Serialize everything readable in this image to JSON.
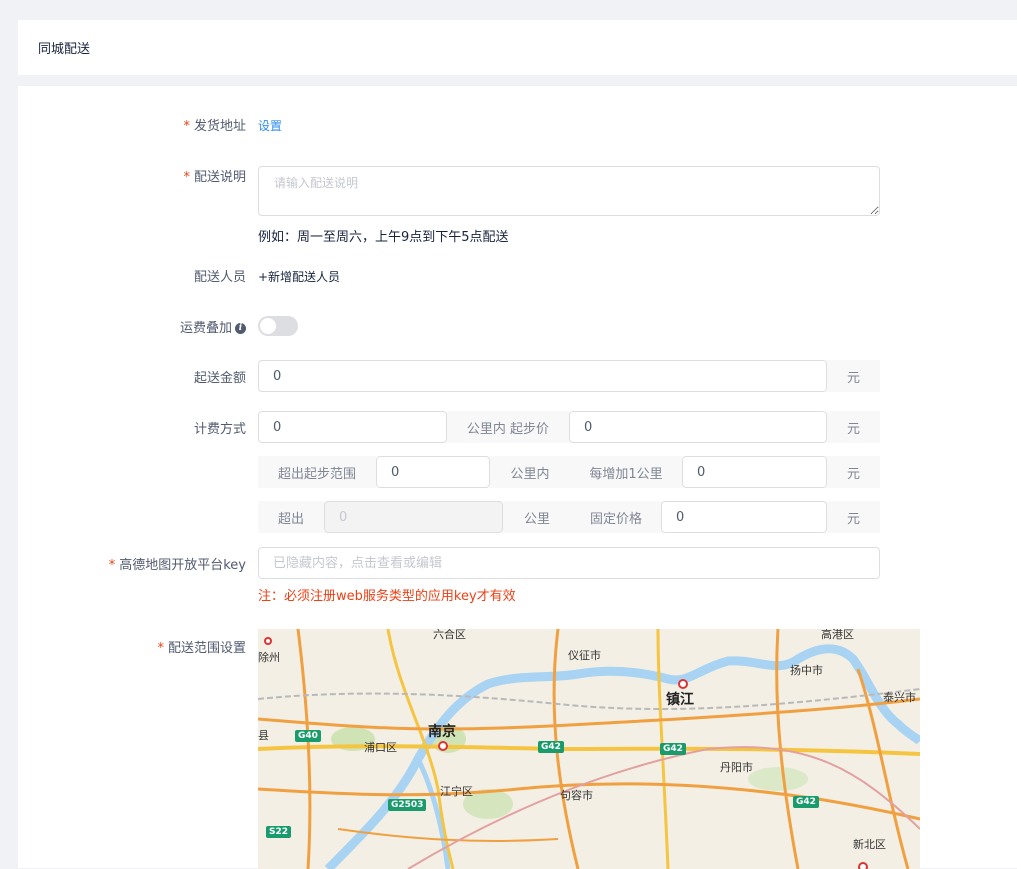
{
  "header": {
    "title": "同城配送"
  },
  "form": {
    "address": {
      "label": "发货地址",
      "action": "设置"
    },
    "description": {
      "label": "配送说明",
      "placeholder": "请输入配送说明",
      "hint": "例如：周一至周六，上午9点到下午5点配送"
    },
    "courier": {
      "label": "配送人员",
      "action": "+新增配送人员"
    },
    "fee_stack": {
      "label": "运费叠加",
      "info": "i",
      "enabled": false
    },
    "min_amount": {
      "label": "起送金额",
      "value": "0",
      "unit": "元"
    },
    "billing": {
      "label": "计费方式",
      "base_km": "0",
      "base_km_addon": "公里内 起步价",
      "base_price": "0",
      "unit": "元",
      "beyond_label": "超出起步范围",
      "beyond_km": "0",
      "within_label": "公里内",
      "per_km_label": "每增加1公里",
      "per_km_price": "0",
      "over_label": "超出",
      "over_km": "0",
      "km_label": "公里",
      "fixed_label": "固定价格",
      "fixed_price": "0"
    },
    "amap_key": {
      "label": "高德地图开放平台key",
      "placeholder": "已隐藏内容，点击查看或编辑",
      "warning": "注：必须注册web服务类型的应用key才有效"
    },
    "range": {
      "label": "配送范围设置"
    }
  },
  "map": {
    "labels": {
      "nanjing": "南京",
      "zhenjiang": "镇江",
      "yizheng": "仪征市",
      "chuzhou": "除州",
      "pukou": "浦口区",
      "jiangning": "江宁区",
      "jurong": "句容市",
      "danyang": "丹阳市",
      "yangzhong": "扬中市",
      "taixing": "泰兴市",
      "gaogang": "高港区",
      "xinbei": "新北区",
      "liuhe": "六合区",
      "xian": "县"
    },
    "shields": {
      "g40": "G40",
      "g42a": "G42",
      "g42b": "G42",
      "g42c": "G42",
      "g2503": "G2503",
      "s22": "S22"
    }
  }
}
